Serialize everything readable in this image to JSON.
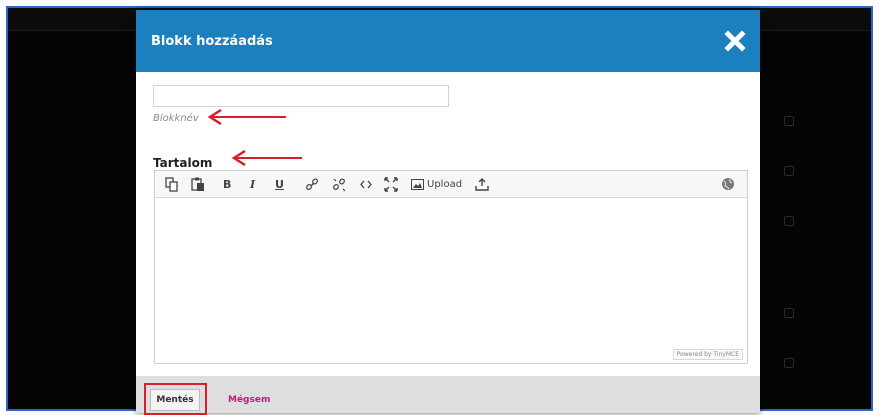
{
  "modal": {
    "title": "Blokk hozzáadás"
  },
  "form": {
    "name_value": "",
    "name_label": "Blokknév",
    "content_label": "Tartalom"
  },
  "editor": {
    "toolbar": {
      "bold": "B",
      "italic": "I",
      "underline": "U",
      "upload_label": "Upload"
    },
    "powered_by": "Powered by TinyMCE"
  },
  "footer": {
    "save_label": "Mentés",
    "cancel_label": "Mégsem"
  },
  "colors": {
    "header": "#1b80bd",
    "annotation": "#d6202a",
    "cancel": "#c01a7a"
  },
  "icons": [
    "close-icon",
    "copy-icon",
    "paste-icon",
    "link-icon",
    "unlink-icon",
    "code-icon",
    "fullscreen-icon",
    "image-icon",
    "upload-file-icon",
    "globe-icon"
  ]
}
